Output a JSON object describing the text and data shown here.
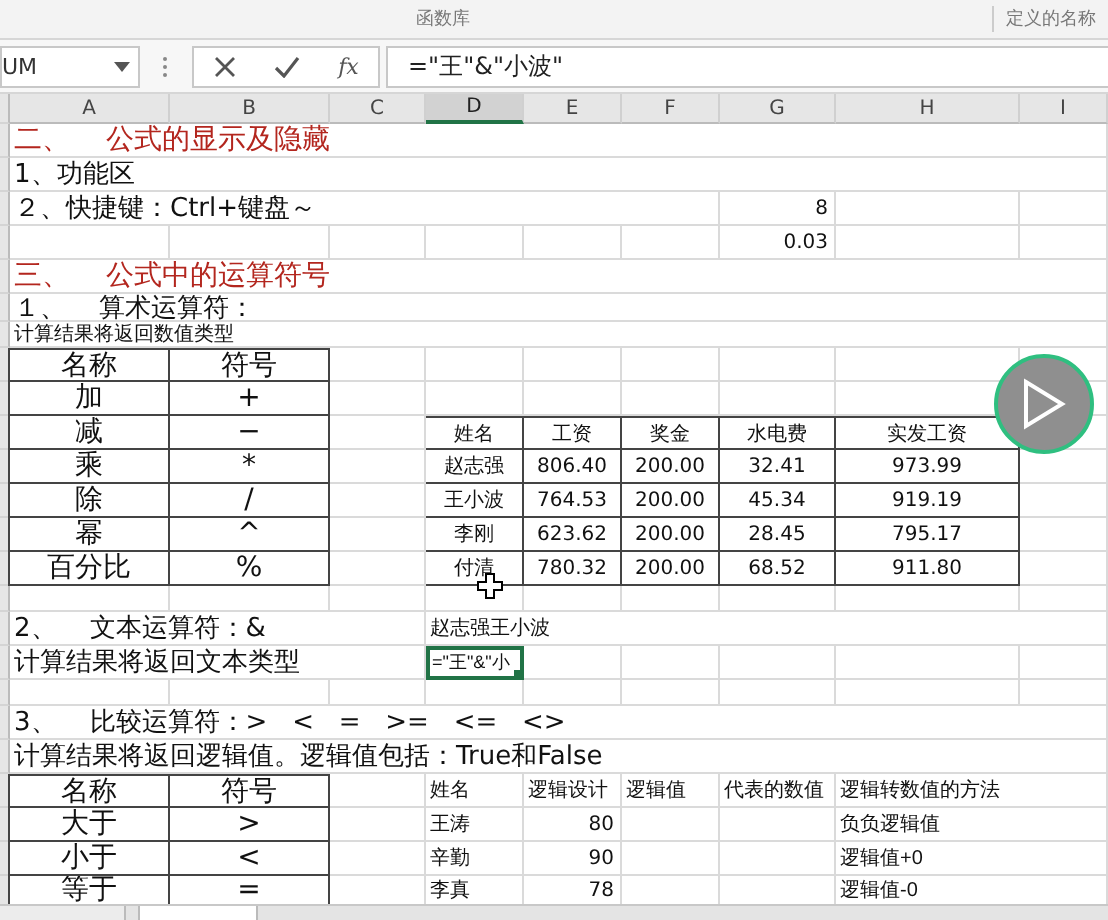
{
  "ribbon": {
    "groups": [
      {
        "label": "函数库"
      },
      {
        "label": "定义的名称"
      }
    ]
  },
  "formula_bar": {
    "name_box": "UM",
    "function_label": "fx",
    "formula": "=\"王\"&\"小波\""
  },
  "columns": [
    {
      "label": "A",
      "selected": false
    },
    {
      "label": "B",
      "selected": false
    },
    {
      "label": "C",
      "selected": false
    },
    {
      "label": "D",
      "selected": true
    },
    {
      "label": "E",
      "selected": false
    },
    {
      "label": "F",
      "selected": false
    },
    {
      "label": "G",
      "selected": false
    },
    {
      "label": "H",
      "selected": false
    },
    {
      "label": "I",
      "selected": false
    }
  ],
  "rows": [
    {
      "A": {
        "kind": "title",
        "text": "二、    公式的显示及隐藏",
        "selected": false
      }
    },
    {
      "A": {
        "kind": "text",
        "text": "1、功能区",
        "selected": false
      }
    },
    {
      "A": {
        "kind": "text",
        "text": "２、快捷键：Ctrl+键盘～",
        "selected": false
      },
      "G": {
        "kind": "number",
        "text": "8",
        "selected": false
      }
    },
    {
      "G": {
        "kind": "number",
        "text": "0.03",
        "selected": false
      }
    },
    {
      "A": {
        "kind": "title",
        "text": "三、    公式中的运算符号",
        "selected": false
      }
    },
    {
      "A": {
        "kind": "text",
        "text": "１、    算术运算符：",
        "selected": false
      }
    },
    {
      "A": {
        "kind": "note",
        "text": "计算结果将返回数值类型",
        "selected": false
      }
    },
    {
      "A": {
        "kind": "boxed",
        "text": "名称",
        "selected": false
      },
      "B": {
        "kind": "boxed",
        "text": "符号",
        "selected": false
      }
    },
    {
      "A": {
        "kind": "boxed",
        "text": "加",
        "selected": false
      },
      "B": {
        "kind": "boxed",
        "text": "+",
        "selected": false
      }
    },
    {
      "A": {
        "kind": "boxed",
        "text": "减",
        "selected": false
      },
      "B": {
        "kind": "boxed",
        "text": "−",
        "selected": false
      },
      "D": {
        "kind": "small-boxed",
        "text": "姓名",
        "selected": false
      },
      "E": {
        "kind": "small-boxed",
        "text": "工资",
        "selected": false
      },
      "F": {
        "kind": "small-boxed",
        "text": "奖金",
        "selected": false
      },
      "G": {
        "kind": "small-boxed",
        "text": "水电费",
        "selected": false
      },
      "H": {
        "kind": "small-boxed",
        "text": "实发工资",
        "selected": false
      }
    },
    {
      "A": {
        "kind": "boxed",
        "text": "乘",
        "selected": false
      },
      "B": {
        "kind": "boxed",
        "text": "*",
        "selected": false
      },
      "D": {
        "kind": "small-boxed",
        "text": "赵志强",
        "selected": false
      },
      "E": {
        "kind": "small-boxed",
        "text": "806.40",
        "selected": false
      },
      "F": {
        "kind": "small-boxed",
        "text": "200.00",
        "selected": false
      },
      "G": {
        "kind": "small-boxed",
        "text": "32.41",
        "selected": false
      },
      "H": {
        "kind": "small-boxed",
        "text": "973.99",
        "selected": false
      }
    },
    {
      "A": {
        "kind": "boxed",
        "text": "除",
        "selected": false
      },
      "B": {
        "kind": "boxed",
        "text": "/",
        "selected": false
      },
      "D": {
        "kind": "small-boxed",
        "text": "王小波",
        "selected": false
      },
      "E": {
        "kind": "small-boxed",
        "text": "764.53",
        "selected": false
      },
      "F": {
        "kind": "small-boxed",
        "text": "200.00",
        "selected": false
      },
      "G": {
        "kind": "small-boxed",
        "text": "45.34",
        "selected": false
      },
      "H": {
        "kind": "small-boxed",
        "text": "919.19",
        "selected": false
      }
    },
    {
      "A": {
        "kind": "boxed",
        "text": "幂",
        "selected": false
      },
      "B": {
        "kind": "boxed",
        "text": "^",
        "selected": false
      },
      "D": {
        "kind": "small-boxed",
        "text": "李刚",
        "selected": false
      },
      "E": {
        "kind": "small-boxed",
        "text": "623.62",
        "selected": false
      },
      "F": {
        "kind": "small-boxed",
        "text": "200.00",
        "selected": false
      },
      "G": {
        "kind": "small-boxed",
        "text": "28.45",
        "selected": false
      },
      "H": {
        "kind": "small-boxed",
        "text": "795.17",
        "selected": false
      }
    },
    {
      "A": {
        "kind": "boxed",
        "text": "百分比",
        "selected": false
      },
      "B": {
        "kind": "boxed",
        "text": "%",
        "selected": false
      },
      "D": {
        "kind": "small-boxed",
        "text": "付清",
        "selected": false
      },
      "E": {
        "kind": "small-boxed",
        "text": "780.32",
        "selected": false
      },
      "F": {
        "kind": "small-boxed",
        "text": "200.00",
        "selected": false
      },
      "G": {
        "kind": "small-boxed",
        "text": "68.52",
        "selected": false
      },
      "H": {
        "kind": "small-boxed",
        "text": "911.80",
        "selected": false
      }
    },
    {},
    {
      "A": {
        "kind": "text",
        "text": "2、    文本运算符：&",
        "selected": false
      },
      "D": {
        "kind": "small",
        "text": "赵志强王小波",
        "selected": false
      }
    },
    {
      "A": {
        "kind": "text",
        "text": "计算结果将返回文本类型",
        "selected": false
      },
      "D": {
        "kind": "small",
        "text": "=\"王\"&\"小",
        "selected": true
      }
    },
    {},
    {
      "A": {
        "kind": "text",
        "text": "3、    比较运算符：>   <   =   >=   <=   <>",
        "selected": false
      }
    },
    {
      "A": {
        "kind": "text",
        "text": "计算结果将返回逻辑值。逻辑值包括：True和False",
        "selected": false
      }
    },
    {
      "A": {
        "kind": "boxed",
        "text": "名称",
        "selected": false
      },
      "B": {
        "kind": "boxed",
        "text": "符号",
        "selected": false
      },
      "D": {
        "kind": "small",
        "text": "姓名",
        "selected": false
      },
      "E": {
        "kind": "small",
        "text": "逻辑设计",
        "selected": false
      },
      "F": {
        "kind": "small",
        "text": "逻辑值",
        "selected": false
      },
      "G": {
        "kind": "small",
        "text": "代表的数值",
        "selected": false
      },
      "H": {
        "kind": "small",
        "text": "逻辑转数值的方法",
        "selected": false
      }
    },
    {
      "A": {
        "kind": "boxed",
        "text": "大于",
        "selected": false
      },
      "B": {
        "kind": "boxed",
        "text": ">",
        "selected": false
      },
      "D": {
        "kind": "small",
        "text": "王涛",
        "selected": false
      },
      "E": {
        "kind": "number",
        "text": "80",
        "selected": false
      },
      "H": {
        "kind": "small",
        "text": "负负逻辑值",
        "selected": false
      }
    },
    {
      "A": {
        "kind": "boxed",
        "text": "小于",
        "selected": false
      },
      "B": {
        "kind": "boxed",
        "text": "<",
        "selected": false
      },
      "D": {
        "kind": "small",
        "text": "辛勤",
        "selected": false
      },
      "E": {
        "kind": "number",
        "text": "90",
        "selected": false
      },
      "H": {
        "kind": "small",
        "text": "逻辑值+0",
        "selected": false
      }
    },
    {
      "A": {
        "kind": "boxed",
        "text": "等于",
        "selected": false
      },
      "B": {
        "kind": "boxed",
        "text": "=",
        "selected": false
      },
      "D": {
        "kind": "small",
        "text": "李真",
        "selected": false
      },
      "E": {
        "kind": "number",
        "text": "78",
        "selected": false
      },
      "H": {
        "kind": "small",
        "text": "逻辑值-0",
        "selected": false
      }
    }
  ]
}
